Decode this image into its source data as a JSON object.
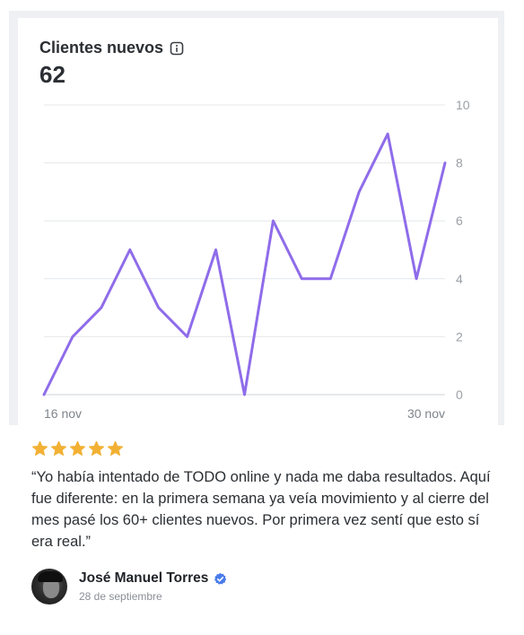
{
  "widget": {
    "title": "Clientes nuevos",
    "total": "62"
  },
  "chart_data": {
    "type": "line",
    "x_tick_labels": [
      "16 nov",
      "30 nov"
    ],
    "x": [
      "16 nov",
      "17 nov",
      "18 nov",
      "19 nov",
      "20 nov",
      "21 nov",
      "22 nov",
      "23 nov",
      "24 nov",
      "25 nov",
      "26 nov",
      "27 nov",
      "28 nov",
      "29 nov",
      "30 nov"
    ],
    "series": [
      {
        "values": [
          0,
          2,
          3,
          5,
          3,
          2,
          5,
          0,
          6,
          4,
          4,
          7,
          9,
          4,
          8
        ]
      }
    ],
    "ylim": [
      0,
      10
    ],
    "yticks": [
      0,
      2,
      4,
      6,
      8,
      10
    ],
    "y_axis_position": "right",
    "grid": true,
    "line_color": "#8f6cea"
  },
  "review": {
    "rating": 5,
    "star_color": "#f2b134",
    "quote": "“Yo había intentado de TODO online y nada me daba resultados. Aquí fue diferente: en la primera semana ya veía movimiento y al cierre del mes pasé los 60+ clientes nuevos. Por primera vez sentí que esto sí era real.”",
    "author_name": "José Manuel Torres",
    "date": "28 de septiembre",
    "verified_color": "#4a7bea"
  }
}
